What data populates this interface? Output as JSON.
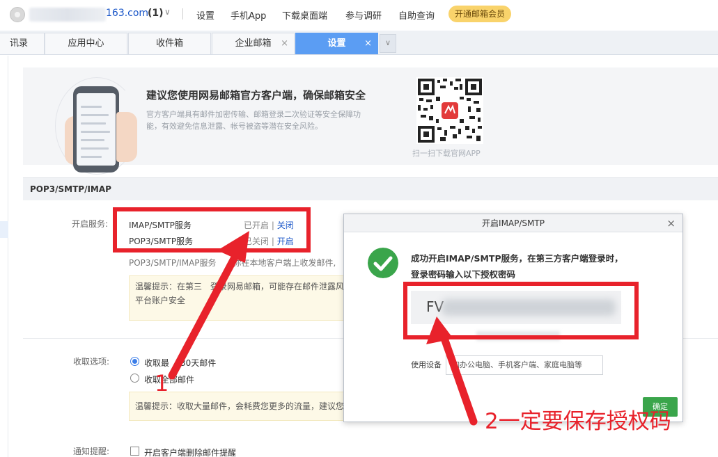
{
  "topbar": {
    "email_suffix": "163.com",
    "unread_count": "(1)",
    "caret": "∨",
    "nav": [
      "设置",
      "手机App",
      "下载桌面端",
      "参与调研",
      "自助查询"
    ],
    "vip_label": "开通邮箱会员"
  },
  "tabs": [
    {
      "label": "讯录"
    },
    {
      "label": "应用中心"
    },
    {
      "label": "收件箱"
    },
    {
      "label": "企业邮箱",
      "close": "×"
    },
    {
      "label": "设置",
      "close": "×",
      "active": true
    }
  ],
  "tab_more": "∨",
  "banner": {
    "title": "建议您使用网易邮箱官方客户端，确保邮箱安全",
    "desc": "官方客户端具有邮件加密传输、邮箱登录二次验证等安全保障功能，有效避免信息泄露、帐号被盗等潜在安全风险。",
    "qr_caption": "扫一扫下载官网APP"
  },
  "section": {
    "title": "POP3/SMTP/IMAP",
    "enable_label": "开启服务:",
    "services": [
      {
        "name": "IMAP/SMTP服务",
        "state": "已开启",
        "sep": "|",
        "action": "关闭"
      },
      {
        "name": "POP3/SMTP服务",
        "state": "已关闭",
        "sep": "|",
        "action": "开启"
      }
    ],
    "service_note_a": "POP3/SMTP/IMAP服务",
    "service_note_b": "你在本地客户端上收发邮件,",
    "tip1_line1": "温馨提示：在第三",
    "tip1_line1b": "登录网易邮箱，可能存在邮件泄露风",
    "tip1_line2": "平台账户安全",
    "fetch_label": "收取选项:",
    "fetch_options": [
      {
        "a": "收取最",
        "b": "30天邮件",
        "checked": true
      },
      {
        "a": "收取全部邮件",
        "checked": false
      }
    ],
    "tip2": "温馨提示：收取大量邮件，会耗费您更多的流量，建议您",
    "notify_label": "通知提醒:",
    "notify_option": "开启客户端删除邮件提醒"
  },
  "dialog": {
    "title": "开启IMAP/SMTP",
    "close": "×",
    "message": "成功开启IMAP/SMTP服务，在第三方客户端登录时，登录密码输入以下授权密码",
    "code_prefix": "FV",
    "device_label": "使用设备",
    "device_placeholder": "如办公电脑、手机客户端、家庭电脑等",
    "ok_label": "确定"
  },
  "annotations": {
    "label1": "1",
    "label2": "2一定要保存授权码",
    "color": "#e8222b"
  }
}
